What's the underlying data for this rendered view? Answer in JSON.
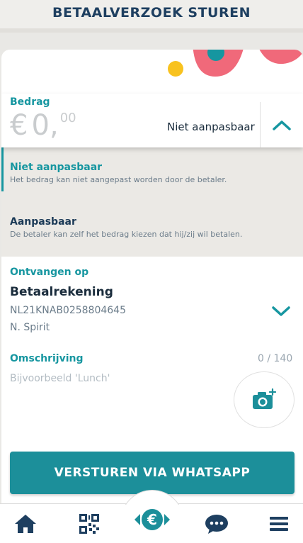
{
  "header": {
    "title": "BETAALVERZOEK STUREN"
  },
  "amount": {
    "label": "Bedrag",
    "currency_symbol": "€",
    "value_main": "0,",
    "value_cents": "00",
    "mode": "Niet aanpasbaar"
  },
  "options": [
    {
      "title": "Niet aanpasbaar",
      "description": "Het bedrag kan niet aangepast worden door de betaler.",
      "selected": true
    },
    {
      "title": "Aanpasbaar",
      "description": "De betaler kan zelf het bedrag kiezen dat hij/zij wil betalen.",
      "selected": false
    }
  ],
  "account": {
    "label": "Ontvangen op",
    "name": "Betaalrekening",
    "iban": "NL21KNAB0258804645",
    "holder": "N. Spirit"
  },
  "description": {
    "label": "Omschrijving",
    "counter": "0 / 140",
    "placeholder": "Bijvoorbeeld 'Lunch'",
    "value": ""
  },
  "send_button": {
    "label": "VERSTUREN VIA WHATSAPP"
  },
  "tabbar": {
    "items": [
      {
        "icon": "home-icon"
      },
      {
        "icon": "qr-code-icon"
      },
      {
        "icon": "euro-transfer-icon"
      },
      {
        "icon": "chat-icon"
      },
      {
        "icon": "menu-icon"
      }
    ]
  },
  "colors": {
    "accent": "#1696a0",
    "button": "#1c8f9a",
    "navy": "#1e3f60",
    "coral": "#f0697a",
    "yellow": "#f8c21f"
  }
}
